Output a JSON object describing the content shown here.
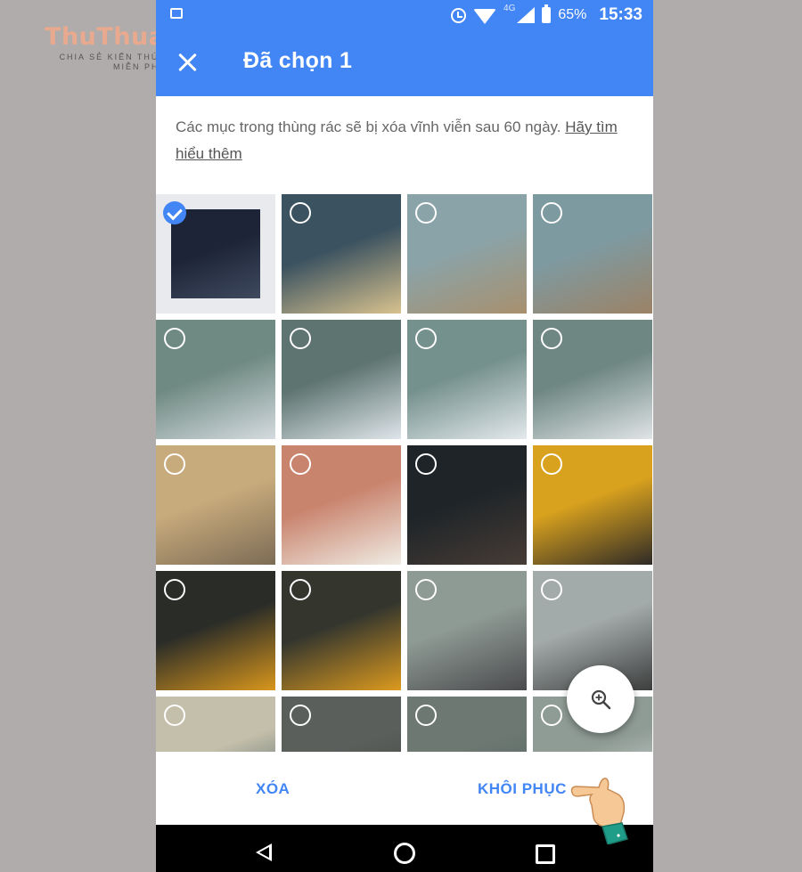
{
  "watermark": {
    "logo": "ThuThuatApp",
    "tagline": "CHIA SẺ KIẾN THỨC TIN HỌC MIỄN PHÍ"
  },
  "statusbar": {
    "network": "4G",
    "battery": "65%",
    "time": "15:33"
  },
  "toolbar": {
    "title": "Đã chọn 1"
  },
  "info": {
    "text": "Các mục trong thùng rác sẽ bị xóa vĩnh viễn sau 60 ngày.",
    "link": "Hãy tìm hiểu thêm"
  },
  "actions": {
    "delete_label": "XÓA",
    "restore_label": "KHÔI PHỤC"
  },
  "photos": [
    {
      "selected": true,
      "colors": [
        "#1d2438",
        "#3f4a5e"
      ]
    },
    {
      "selected": false,
      "colors": [
        "#3b5260",
        "#d8c28e"
      ]
    },
    {
      "selected": false,
      "colors": [
        "#8aa3a8",
        "#a8906e"
      ]
    },
    {
      "selected": false,
      "colors": [
        "#7e9aa1",
        "#9c8266"
      ]
    },
    {
      "selected": false,
      "colors": [
        "#6f8a82",
        "#d5dbe0"
      ]
    },
    {
      "selected": false,
      "colors": [
        "#5d7470",
        "#dfe5ea"
      ]
    },
    {
      "selected": false,
      "colors": [
        "#75918d",
        "#e4e9ec"
      ]
    },
    {
      "selected": false,
      "colors": [
        "#6e8782",
        "#e0e4e6"
      ]
    },
    {
      "selected": false,
      "colors": [
        "#c8ab7c",
        "#7c6b55"
      ]
    },
    {
      "selected": false,
      "colors": [
        "#c9846e",
        "#f0ece4"
      ]
    },
    {
      "selected": false,
      "colors": [
        "#1e2428",
        "#473c36"
      ]
    },
    {
      "selected": false,
      "colors": [
        "#d9a21e",
        "#2e2a26"
      ]
    },
    {
      "selected": false,
      "colors": [
        "#2a2c28",
        "#d8961c"
      ]
    },
    {
      "selected": false,
      "colors": [
        "#34362e",
        "#dc9a1e"
      ]
    },
    {
      "selected": false,
      "colors": [
        "#8e9a94",
        "#4b4b4e"
      ]
    },
    {
      "selected": false,
      "colors": [
        "#a3abaa",
        "#3d3e3e"
      ]
    },
    {
      "selected": false,
      "colors": [
        "#c4bfaa",
        "#3c5560"
      ]
    },
    {
      "selected": false,
      "colors": [
        "#5a5f5c",
        "#42463f"
      ]
    },
    {
      "selected": false,
      "colors": [
        "#6d7873",
        "#506058"
      ]
    },
    {
      "selected": false,
      "colors": [
        "#8f9b95",
        "#e3e6e6"
      ]
    }
  ]
}
